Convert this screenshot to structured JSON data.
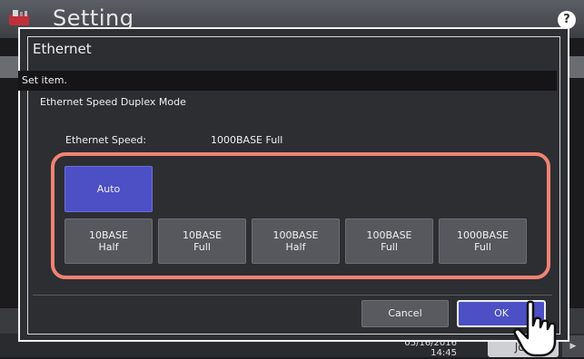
{
  "app": {
    "title": "Setting",
    "help_label": "?"
  },
  "dialog": {
    "title": "Ethernet",
    "message": "Set item.",
    "subtitle": "Ethernet Speed Duplex Mode",
    "speed_label": "Ethernet Speed:",
    "speed_value": "1000BASE Full",
    "options": [
      {
        "label": "Auto",
        "selected": true
      },
      {
        "label": "10BASE\nHalf",
        "selected": false
      },
      {
        "label": "10BASE\nFull",
        "selected": false
      },
      {
        "label": "100BASE\nHalf",
        "selected": false
      },
      {
        "label": "100BASE\nFull",
        "selected": false
      },
      {
        "label": "1000BASE\nFull",
        "selected": false
      }
    ],
    "cancel_label": "Cancel",
    "ok_label": "OK"
  },
  "footer": {
    "date": "05/16/2016",
    "time": "14:45",
    "job_label": "Job",
    "arrow_label": "▶"
  },
  "colors": {
    "accent": "#4d4fc4",
    "highlight": "#ef8472"
  }
}
